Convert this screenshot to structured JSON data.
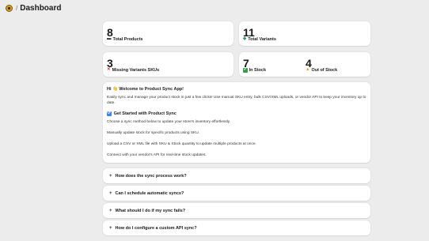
{
  "header": {
    "title": "Dashboard",
    "separator": "/"
  },
  "stats": {
    "total_products": {
      "value": "8",
      "label": "Total Products",
      "icon": "folder-icon"
    },
    "total_variants": {
      "value": "11",
      "label": "Total Variants",
      "icon": "gem-icon"
    },
    "missing_variants": {
      "value": "3",
      "label": "Missing Variants SKUs",
      "icon": "cross-icon"
    },
    "in_stock": {
      "value": "7",
      "label": "In Stock",
      "icon": "check-box-icon"
    },
    "out_of_stock": {
      "value": "4",
      "label": "Out of Stock",
      "icon": "warning-icon"
    }
  },
  "welcome": {
    "title": "Hi 👋 Welcome to Product Sync App!",
    "intro": "Easily sync and manage your product stock in just a few clicks! Use manual SKU entry, bulk CSV/XML uploads, or vendor API to keep your inventory up to date.",
    "get_started": "Get Started with Product Sync",
    "choose": "Choose a sync method below to update your store's inventory effortlessly.",
    "manual": "Manually update stock for specific products using SKU.",
    "upload": "Upload a CSV or XML file with SKU & Stock quantity to update multiple products at once.",
    "api": "Connect with your vendor's API for real-time stock updates."
  },
  "faq": [
    {
      "question": "How does the sync process work?"
    },
    {
      "question": "Can I schedule automatic syncs?"
    },
    {
      "question": "What should I do if my sync fails?"
    },
    {
      "question": "How do I configure a custom API sync?"
    }
  ],
  "colors": {
    "background": "#ececec",
    "card": "#ffffff",
    "accent_app_icon": "#d9a21b"
  }
}
